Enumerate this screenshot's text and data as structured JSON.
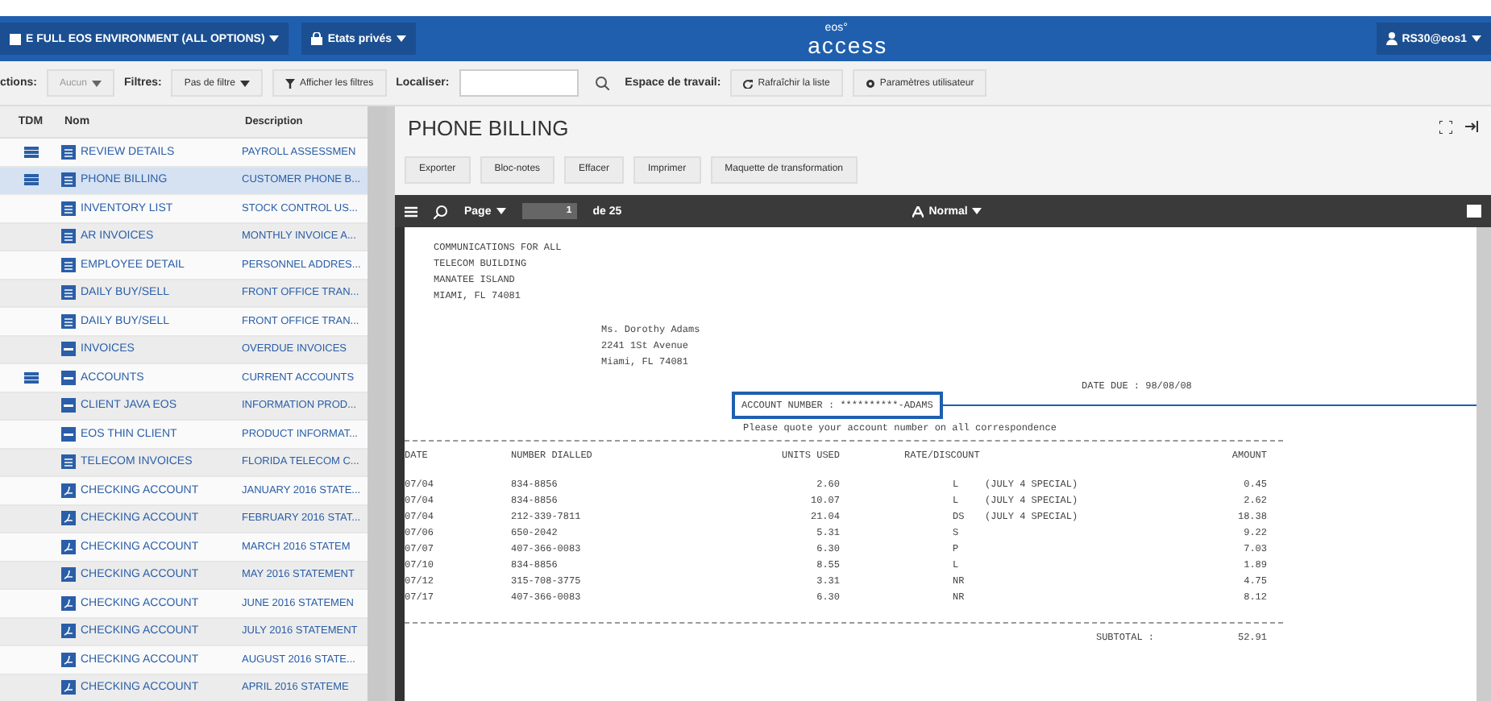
{
  "header": {
    "environment": "E FULL EOS ENVIRONMENT (ALL OPTIONS)",
    "reports_menu": "Etats privés",
    "logo_top": "eos°",
    "logo": "access",
    "user": "RS30@eos1"
  },
  "toolbar": {
    "actions_label": "ctions:",
    "actions_value": "Aucun",
    "filters_label": "Filtres:",
    "filters_value": "Pas de filtre",
    "show_filters": "Afficher les filtres",
    "locate_label": "Localiser:",
    "workspace_label": "Espace de travail:",
    "refresh": "Rafraîchir la liste",
    "user_settings": "Paramètres utilisateur"
  },
  "list": {
    "columns": [
      "TDM",
      "Nom",
      "Description"
    ],
    "rows": [
      {
        "tdm": true,
        "kind": "doc",
        "name": "REVIEW DETAILS",
        "description": "PAYROLL ASSESSMEN",
        "selected": false
      },
      {
        "tdm": true,
        "kind": "doc",
        "name": "PHONE BILLING",
        "description": "CUSTOMER PHONE B...",
        "selected": true
      },
      {
        "tdm": false,
        "kind": "doc",
        "name": "INVENTORY LIST",
        "description": "STOCK CONTROL US...",
        "selected": false
      },
      {
        "tdm": false,
        "kind": "doc",
        "name": "AR INVOICES",
        "description": "MONTHLY INVOICE A...",
        "selected": false
      },
      {
        "tdm": false,
        "kind": "doc",
        "name": "EMPLOYEE DETAIL",
        "description": "PERSONNEL ADDRES...",
        "selected": false
      },
      {
        "tdm": false,
        "kind": "doc",
        "name": "DAILY BUY/SELL",
        "description": "FRONT OFFICE TRAN...",
        "selected": false
      },
      {
        "tdm": false,
        "kind": "doc",
        "name": "DAILY BUY/SELL",
        "description": "FRONT OFFICE TRAN...",
        "selected": false
      },
      {
        "tdm": false,
        "kind": "bar",
        "name": "INVOICES",
        "description": "OVERDUE INVOICES",
        "selected": false
      },
      {
        "tdm": true,
        "kind": "bar",
        "name": "ACCOUNTS",
        "description": "CURRENT ACCOUNTS",
        "selected": false
      },
      {
        "tdm": false,
        "kind": "bar",
        "name": "CLIENT JAVA EOS",
        "description": "INFORMATION PROD...",
        "selected": false
      },
      {
        "tdm": false,
        "kind": "bar",
        "name": "EOS THIN CLIENT",
        "description": "PRODUCT INFORMAT...",
        "selected": false
      },
      {
        "tdm": false,
        "kind": "doc",
        "name": "TELECOM INVOICES",
        "description": "FLORIDA TELECOM C...",
        "selected": false
      },
      {
        "tdm": false,
        "kind": "pdf",
        "name": "CHECKING ACCOUNT",
        "description": "JANUARY 2016 STATE...",
        "selected": false
      },
      {
        "tdm": false,
        "kind": "pdf",
        "name": "CHECKING ACCOUNT",
        "description": "FEBRUARY 2016 STAT...",
        "selected": false
      },
      {
        "tdm": false,
        "kind": "pdf",
        "name": "CHECKING ACCOUNT",
        "description": "MARCH 2016 STATEM",
        "selected": false
      },
      {
        "tdm": false,
        "kind": "pdf",
        "name": "CHECKING ACCOUNT",
        "description": "MAY 2016 STATEMENT",
        "selected": false
      },
      {
        "tdm": false,
        "kind": "pdf",
        "name": "CHECKING ACCOUNT",
        "description": "JUNE 2016 STATEMEN",
        "selected": false
      },
      {
        "tdm": false,
        "kind": "pdf",
        "name": "CHECKING ACCOUNT",
        "description": "JULY 2016 STATEMENT",
        "selected": false
      },
      {
        "tdm": false,
        "kind": "pdf",
        "name": "CHECKING ACCOUNT",
        "description": "AUGUST 2016 STATE...",
        "selected": false
      },
      {
        "tdm": false,
        "kind": "pdf",
        "name": "CHECKING ACCOUNT",
        "description": "APRIL 2016 STATEME",
        "selected": false
      }
    ]
  },
  "viewer": {
    "title": "PHONE BILLING",
    "buttons": [
      "Exporter",
      "Bloc-notes",
      "Effacer",
      "Imprimer",
      "Maquette de transformation"
    ],
    "page_menu": "Page",
    "page_number": "1",
    "page_total": "de 25",
    "font_menu": "Normal",
    "document": {
      "sender": [
        "COMMUNICATIONS FOR ALL",
        "TELECOM BUILDING",
        "MANATEE ISLAND",
        "MIAMI,  FL 74081"
      ],
      "recipient": [
        "Ms. Dorothy Adams",
        "2241 1St Avenue",
        "Miami,  FL 74081"
      ],
      "date_due": "DATE DUE : 98/08/08",
      "account_number": "ACCOUNT NUMBER : **********-ADAMS",
      "note": "Please quote your account number on all correspondence",
      "columns": [
        "DATE",
        "NUMBER DIALLED",
        "UNITS USED",
        "RATE/DISCOUNT",
        "AMOUNT"
      ],
      "calls": [
        {
          "date": "07/04",
          "number": "834-8856",
          "units": "2.60",
          "rate": "L",
          "discount": "(JULY 4 SPECIAL)",
          "amount": "0.45"
        },
        {
          "date": "07/04",
          "number": "834-8856",
          "units": "10.07",
          "rate": "L",
          "discount": "(JULY 4 SPECIAL)",
          "amount": "2.62"
        },
        {
          "date": "07/04",
          "number": "212-339-7811",
          "units": "21.04",
          "rate": "DS",
          "discount": "(JULY 4 SPECIAL)",
          "amount": "18.38"
        },
        {
          "date": "07/06",
          "number": "650-2042",
          "units": "5.31",
          "rate": "S",
          "amount": "9.22"
        },
        {
          "date": "07/07",
          "number": "407-366-0083",
          "units": "6.30",
          "rate": "P",
          "amount": "7.03"
        },
        {
          "date": "07/10",
          "number": "834-8856",
          "units": "8.55",
          "rate": "L",
          "amount": "1.89"
        },
        {
          "date": "07/12",
          "number": "315-708-3775",
          "units": "3.31",
          "rate": "NR",
          "amount": "4.75"
        },
        {
          "date": "07/17",
          "number": "407-366-0083",
          "units": "6.30",
          "rate": "NR",
          "amount": "8.12"
        }
      ],
      "subtotal_label": "SUBTOTAL  :",
      "subtotal": "52.91"
    }
  }
}
